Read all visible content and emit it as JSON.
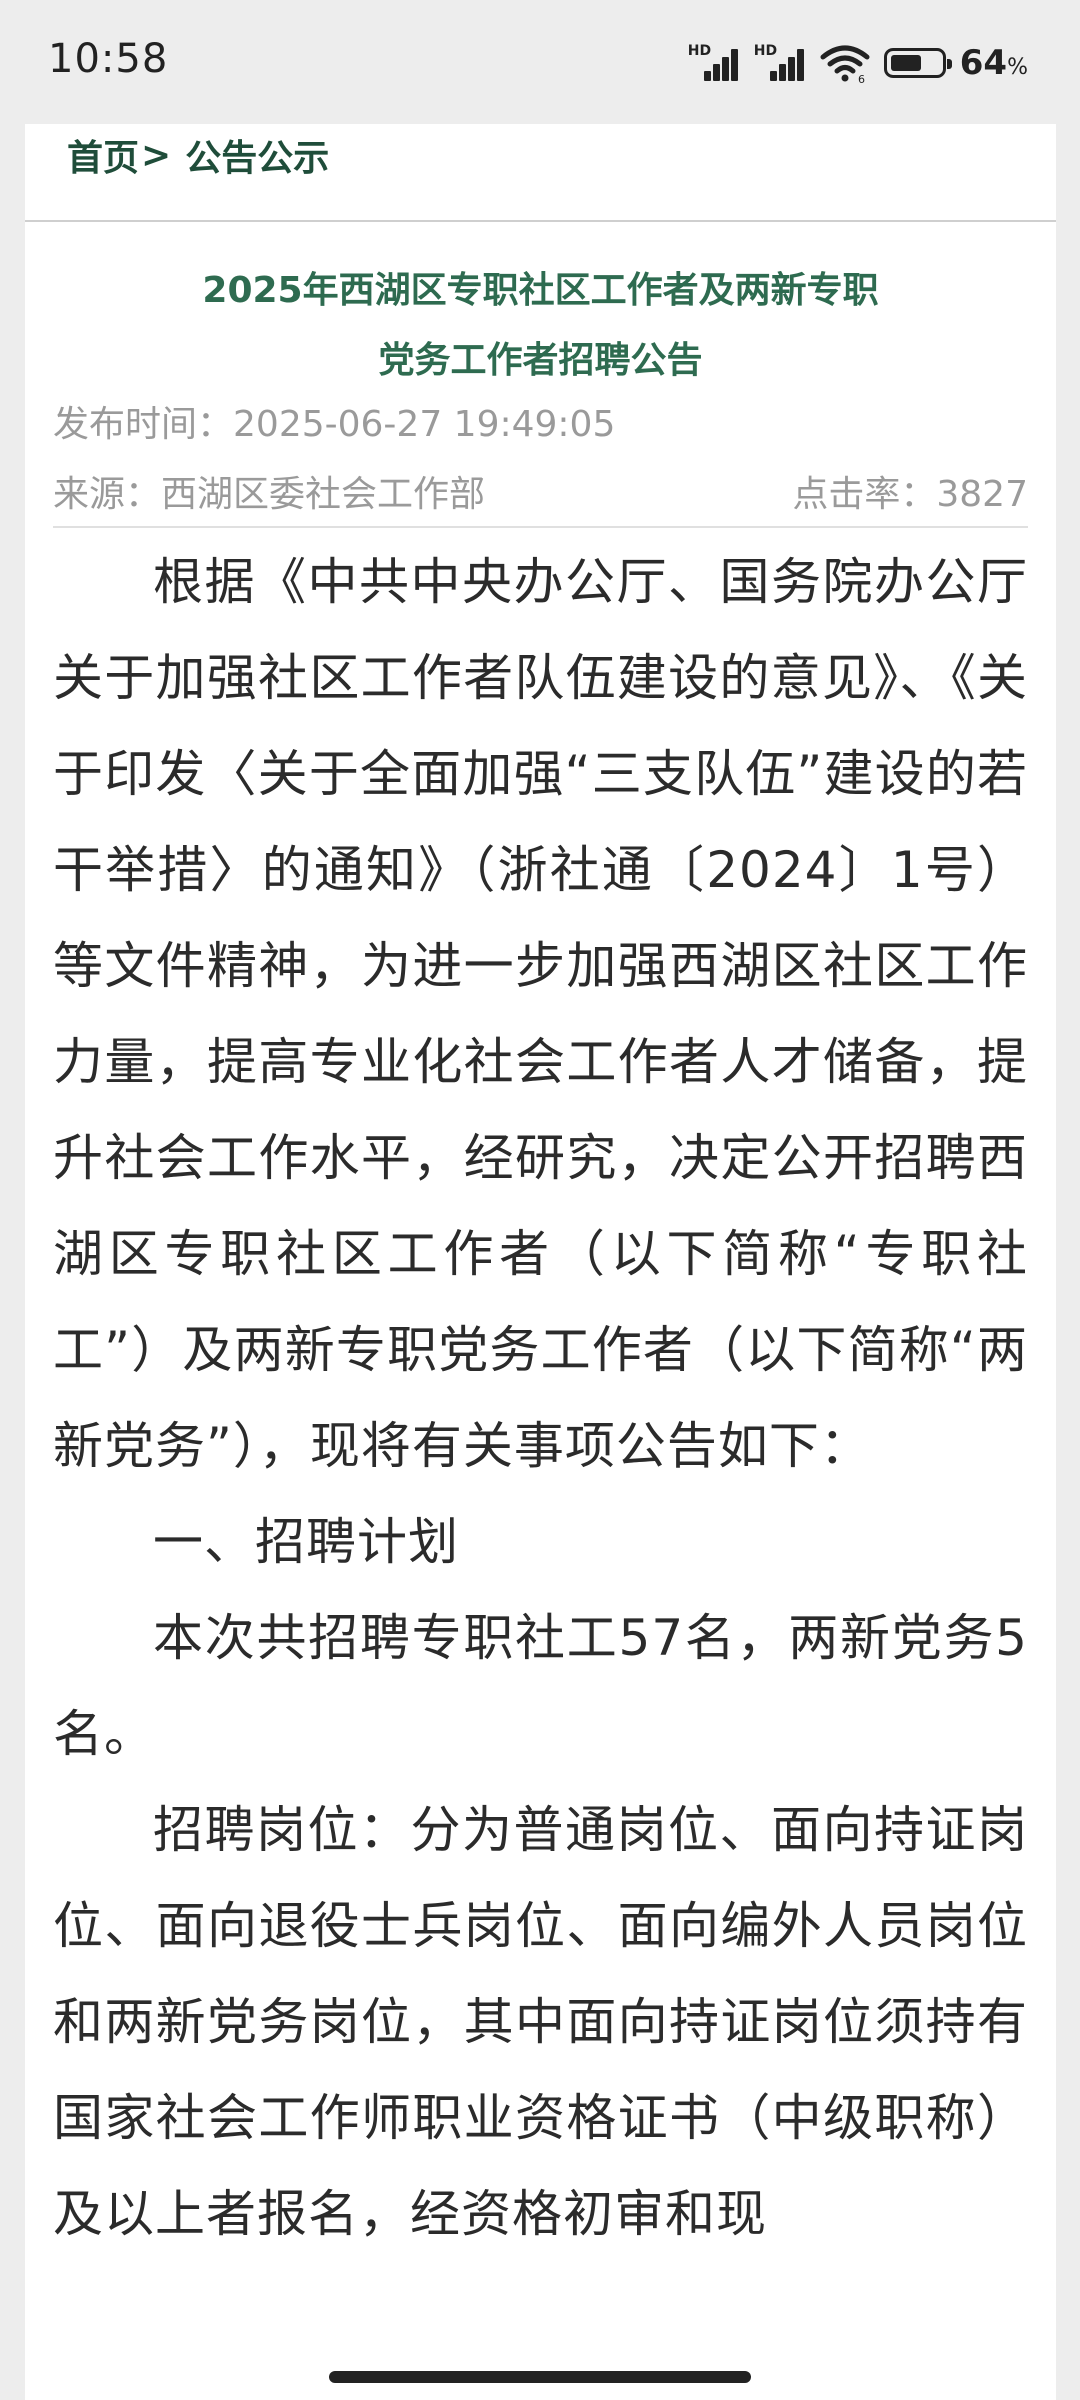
{
  "status_bar": {
    "time": "10:58",
    "signal1_label": "HD",
    "signal2_label": "HD",
    "battery_percent": "64",
    "battery_unit": "%"
  },
  "breadcrumb": {
    "home": "首页",
    "separator": ">",
    "current": "公告公示"
  },
  "article": {
    "title_line1": "2025年西湖区专职社区工作者及两新专职",
    "title_line2": "党务工作者招聘公告",
    "publish_label": "发布时间：",
    "publish_time": "2025-06-27 19:49:05",
    "source_label": "来源：",
    "source": "西湖区委社会工作部",
    "clicks_label": "点击率：",
    "clicks": "3827",
    "paragraphs": [
      "根据《中共中央办公厅、国务院办公厅关于加强社区工作者队伍建设的意见》、《关于印发〈关于全面加强“三支队伍”建设的若干举措〉的通知》（浙社通〔2024〕1号）等文件精神，为进一步加强西湖区社区工作力量，提高专业化社会工作者人才储备，提升社会工作水平，经研究，决定公开招聘西湖区专职社区工作者（以下简称“专职社工”）及两新专职党务工作者（以下简称“两新党务”），现将有关事项公告如下：",
      "一、招聘计划",
      "本次共招聘专职社工57名，两新党务5名。",
      "招聘岗位：分为普通岗位、面向持证岗位、面向退役士兵岗位、面向编外人员岗位和两新党务岗位，其中面向持证岗位须持有国家社会工作师职业资格证书（中级职称）及以上者报名，经资格初审和现"
    ]
  }
}
